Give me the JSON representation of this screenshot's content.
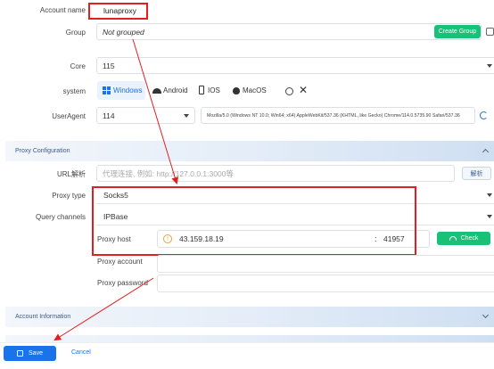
{
  "account": {
    "label": "Account name",
    "value": "lunaproxy"
  },
  "group": {
    "label": "Group",
    "value": "Not grouped",
    "create_button": "Create Group"
  },
  "core": {
    "label": "Core",
    "value": "115"
  },
  "system": {
    "label": "system",
    "options": [
      "Windows",
      "Android",
      "IOS",
      "MacOS"
    ],
    "selected": "Windows"
  },
  "useragent": {
    "label": "UserAgent",
    "version": "114",
    "string": "Mozilla/5.0 (Windows NT 10.0; Win64; x64) AppleWebKit/537.36 (KHTML, like Gecko) Chrome/114.0.5735.90 Safari/537.36"
  },
  "proxy_section": {
    "title": "Proxy Configuration"
  },
  "url_parse": {
    "label": "URL解析",
    "placeholder": "代理连接, 例如: http://127.0.0.1:3000等",
    "button": "解析"
  },
  "proxy_type": {
    "label": "Proxy type",
    "value": "Socks5"
  },
  "query_channels": {
    "label": "Query channels",
    "value": "IPBase"
  },
  "proxy_host": {
    "label": "Proxy host",
    "host": "43.159.18.19",
    "separator": ":",
    "port": "41957",
    "check_button": "Check"
  },
  "proxy_account": {
    "label": "Proxy account",
    "value": ""
  },
  "proxy_password": {
    "label": "Proxy password",
    "value": ""
  },
  "account_section": {
    "title": "Account Information"
  },
  "footer": {
    "save": "Save",
    "cancel": "Cancel"
  },
  "colors": {
    "accent": "#1a73e8",
    "green": "#18c178",
    "annotation_red": "#e02020"
  }
}
